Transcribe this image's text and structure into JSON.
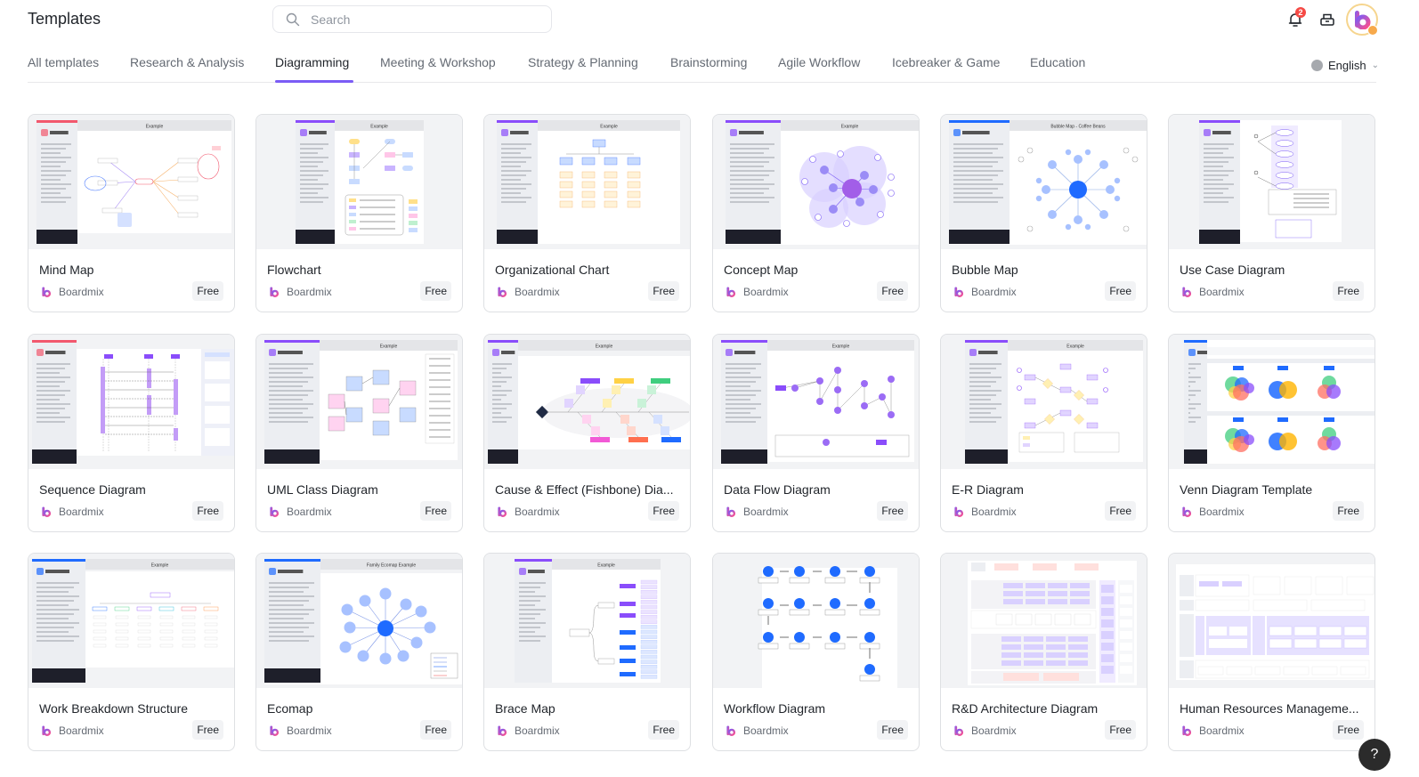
{
  "header": {
    "title": "Templates",
    "search_placeholder": "Search",
    "notification_count": "2",
    "icons": {
      "search": "search-icon",
      "bell": "bell-icon",
      "inbox": "inbox-icon",
      "avatar": "boardmix-avatar"
    }
  },
  "tabs": [
    {
      "label": "All templates",
      "active": false
    },
    {
      "label": "Research & Analysis",
      "active": false
    },
    {
      "label": "Diagramming",
      "active": true
    },
    {
      "label": "Meeting & Workshop",
      "active": false
    },
    {
      "label": "Strategy & Planning",
      "active": false
    },
    {
      "label": "Brainstorming",
      "active": false
    },
    {
      "label": "Agile Workflow",
      "active": false
    },
    {
      "label": "Icebreaker & Game",
      "active": false
    },
    {
      "label": "Education",
      "active": false
    }
  ],
  "language": {
    "label": "English"
  },
  "colors": {
    "accent": "#7b5cf5",
    "badge": "#f54a45"
  },
  "templates": [
    {
      "title": "Mind Map",
      "author": "Boardmix",
      "price": "Free",
      "thumb": "mindmap"
    },
    {
      "title": "Flowchart",
      "author": "Boardmix",
      "price": "Free",
      "thumb": "flowchart"
    },
    {
      "title": "Organizational Chart",
      "author": "Boardmix",
      "price": "Free",
      "thumb": "orgchart"
    },
    {
      "title": "Concept Map",
      "author": "Boardmix",
      "price": "Free",
      "thumb": "concept"
    },
    {
      "title": "Bubble Map",
      "author": "Boardmix",
      "price": "Free",
      "thumb": "bubble"
    },
    {
      "title": "Use Case Diagram",
      "author": "Boardmix",
      "price": "Free",
      "thumb": "usecase"
    },
    {
      "title": "Sequence Diagram",
      "author": "Boardmix",
      "price": "Free",
      "thumb": "sequence"
    },
    {
      "title": "UML Class Diagram",
      "author": "Boardmix",
      "price": "Free",
      "thumb": "uml"
    },
    {
      "title": "Cause & Effect (Fishbone) Dia...",
      "author": "Boardmix",
      "price": "Free",
      "thumb": "fishbone"
    },
    {
      "title": "Data Flow Diagram",
      "author": "Boardmix",
      "price": "Free",
      "thumb": "dataflow"
    },
    {
      "title": "E-R Diagram",
      "author": "Boardmix",
      "price": "Free",
      "thumb": "er"
    },
    {
      "title": "Venn Diagram Template",
      "author": "Boardmix",
      "price": "Free",
      "thumb": "venn"
    },
    {
      "title": "Work Breakdown Structure",
      "author": "Boardmix",
      "price": "Free",
      "thumb": "wbs"
    },
    {
      "title": "Ecomap",
      "author": "Boardmix",
      "price": "Free",
      "thumb": "ecomap"
    },
    {
      "title": "Brace Map",
      "author": "Boardmix",
      "price": "Free",
      "thumb": "brace"
    },
    {
      "title": "Workflow Diagram",
      "author": "Boardmix",
      "price": "Free",
      "thumb": "workflow"
    },
    {
      "title": "R&D Architecture Diagram",
      "author": "Boardmix",
      "price": "Free",
      "thumb": "rnd"
    },
    {
      "title": "Human Resources Manageme...",
      "author": "Boardmix",
      "price": "Free",
      "thumb": "hr"
    }
  ],
  "thumb_labels": {
    "example": "Example",
    "bubble": "Bubble Map - Coffee Beans",
    "ecomap": "Family Ecomap Example"
  },
  "help": {
    "label": "?"
  }
}
